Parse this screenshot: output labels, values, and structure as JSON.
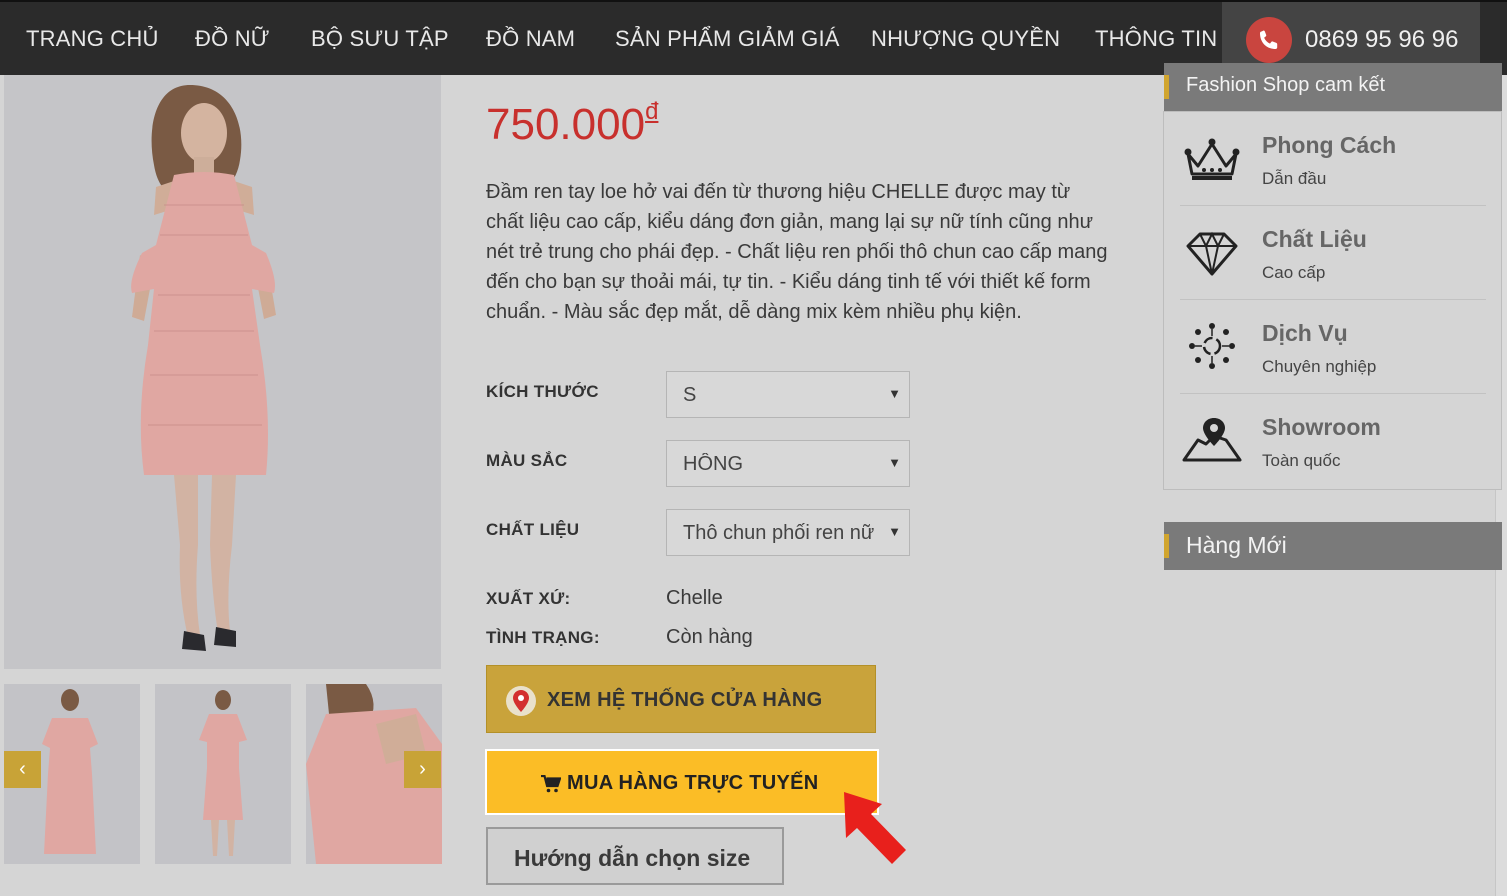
{
  "nav": {
    "items": [
      "TRANG CHỦ",
      "ĐỒ NỮ",
      "BỘ SƯU TẬP",
      "ĐỒ NAM",
      "SẢN PHẨM GIẢM GIÁ",
      "NHƯỢNG QUYỀN",
      "THÔNG TIN"
    ],
    "phone": "0869 95 96 96",
    "phone_icon": "phone-icon"
  },
  "product": {
    "price": "750.000",
    "currency": "đ",
    "description": "Đầm ren tay loe hở vai đến từ thương hiệu CHELLE được may từ chất liệu cao cấp, kiểu dáng đơn giản, mang lại sự nữ tính cũng như nét trẻ trung cho phái đẹp. - Chất liệu ren phối thô chun cao cấp mang đến cho bạn sự thoải mái, tự tin. - Kiểu dáng tinh tế với thiết kế form chuẩn. - Màu sắc đẹp mắt, dễ dàng mix kèm nhiều phụ kiện.",
    "options": {
      "size_label": "KÍCH THƯỚC",
      "size_value": "S",
      "color_label": "MÀU SẮC",
      "color_value": "HỒNG",
      "material_label": "CHẤT LIỆU",
      "material_value": "Thô chun phối ren nữ"
    },
    "origin_label": "XUẤT XỨ:",
    "origin_value": "Chelle",
    "status_label": "TÌNH TRẠNG:",
    "status_value": "Còn hàng",
    "dress_color": "#e8a9a4"
  },
  "buttons": {
    "store": "XEM HỆ THỐNG CỬA HÀNG",
    "buy": "MUA HÀNG TRỰC TUYẾN",
    "size_guide": "Hướng dẫn chọn size"
  },
  "thumbnails": {
    "prev": "‹",
    "next": "›"
  },
  "sidebar": {
    "commit_title": "Fashion Shop cam kết",
    "commitments": [
      {
        "title": "Phong Cách",
        "subtitle": "Dẫn đầu",
        "icon": "crown-icon"
      },
      {
        "title": "Chất Liệu",
        "subtitle": "Cao cấp",
        "icon": "diamond-icon"
      },
      {
        "title": "Dịch Vụ",
        "subtitle": "Chuyên nghiệp",
        "icon": "service-icon"
      },
      {
        "title": "Showroom",
        "subtitle": "Toàn quốc",
        "icon": "map-pin-icon"
      }
    ],
    "new_title": "Hàng Mới"
  },
  "colors": {
    "nav_bg": "#2b2b2b",
    "price": "#c8302d",
    "accent_gold": "#c9a33b",
    "buy_yellow": "#fbbd26",
    "annotation_arrow": "#e8201c"
  }
}
